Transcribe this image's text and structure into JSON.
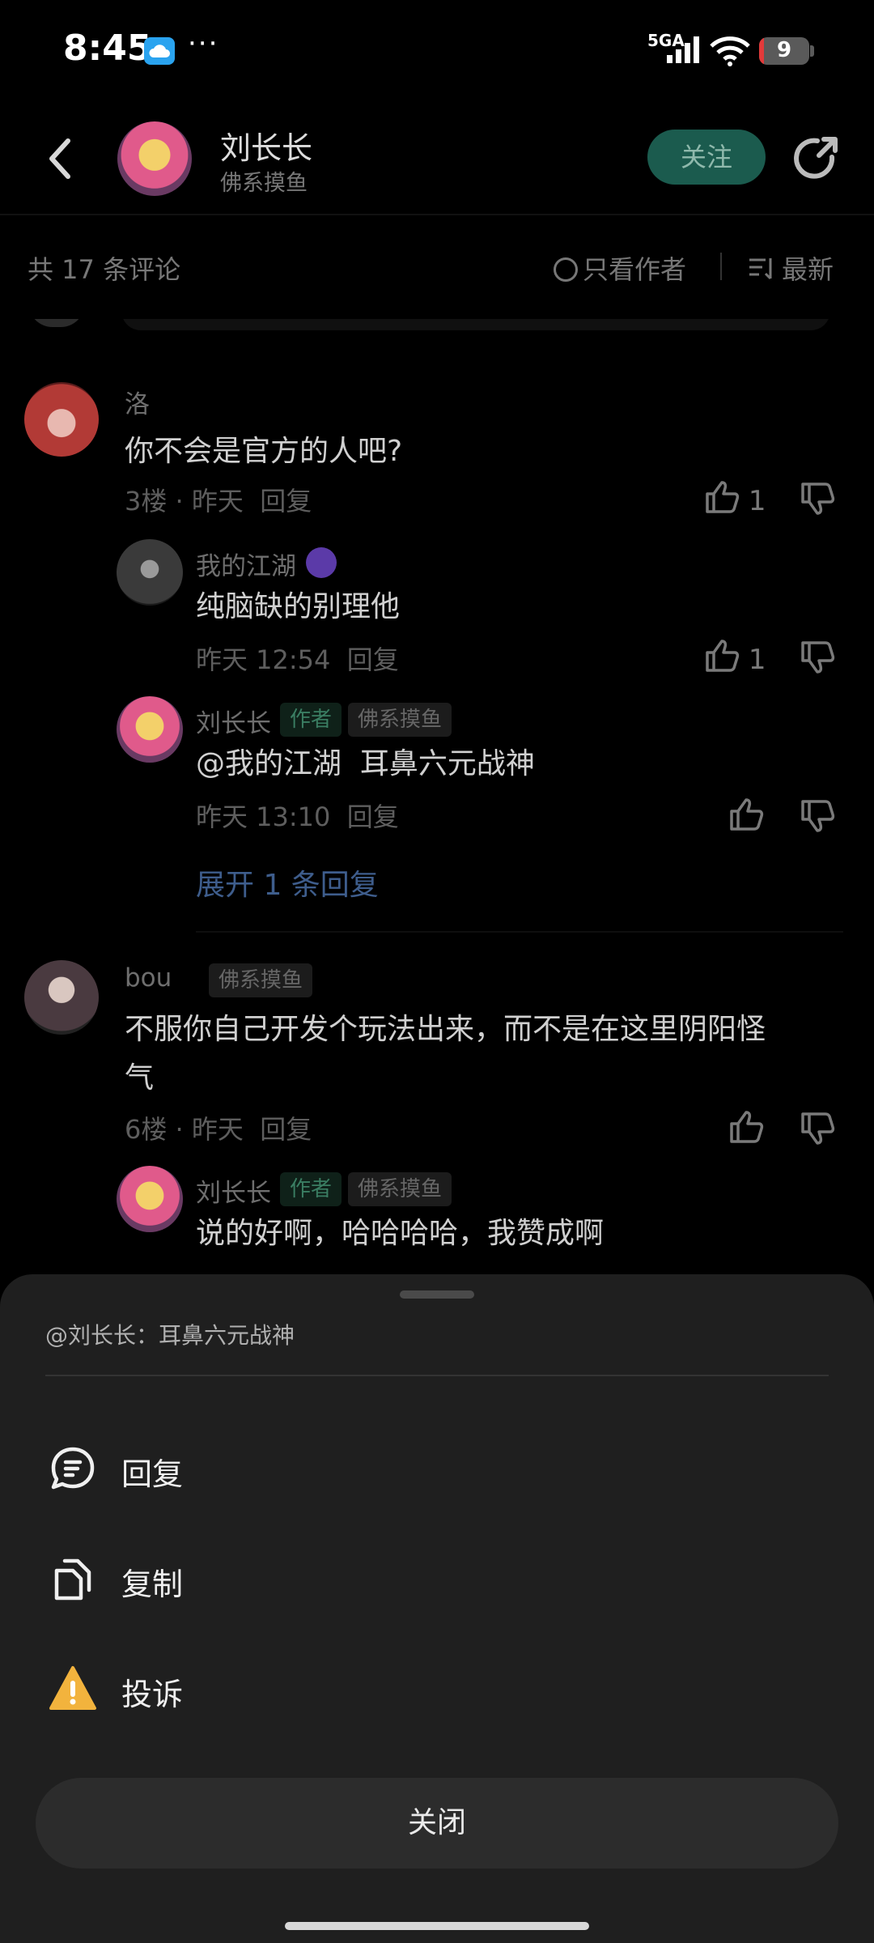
{
  "status_bar": {
    "time": "8:45",
    "network": "5GA",
    "battery": "9",
    "battery_level": 0.09,
    "icons": [
      "cloud-icon",
      "more-dots-icon",
      "signal-icon",
      "wifi-icon",
      "battery-icon"
    ],
    "more": "···"
  },
  "header": {
    "name": "刘长长",
    "subtitle": "佛系摸鱼",
    "follow_label": "关注"
  },
  "sort_bar": {
    "comment_count": "共 17 条评论",
    "author_only": "只看作者",
    "sort_label": "最新"
  },
  "comments": [
    {
      "name": "洛",
      "text": "你不会是官方的人吧?",
      "floor": "3楼",
      "time": "昨天",
      "reply": "回复",
      "likes": "1",
      "replies": [
        {
          "name": "我的江湖",
          "text": "纯脑缺的别理他",
          "time": "昨天 12:54",
          "reply": "回复",
          "likes": "1"
        },
        {
          "name": "刘长长",
          "tag_author": "作者",
          "tag": "佛系摸鱼",
          "mention": "@我的江湖",
          "text": "耳鼻六元战神",
          "time": "昨天 13:10",
          "reply": "回复"
        }
      ],
      "expand": "展开 1 条回复"
    },
    {
      "name": "bou",
      "tag": "佛系摸鱼",
      "text_line1": "不服你自己开发个玩法出来，而不是在这里阴阳怪",
      "text_line2": "气",
      "floor": "6楼",
      "time": "昨天",
      "reply": "回复",
      "replies": [
        {
          "name": "刘长长",
          "tag_author": "作者",
          "tag": "佛系摸鱼",
          "text": "说的好啊，哈哈哈哈，我赞成啊"
        }
      ]
    }
  ],
  "sheet": {
    "quote": "@刘长长：耳鼻六元战神",
    "actions": [
      {
        "label": "回复",
        "icon": "reply-icon"
      },
      {
        "label": "复制",
        "icon": "copy-icon"
      },
      {
        "label": "投诉",
        "icon": "warning-icon"
      }
    ],
    "close_label": "关闭"
  }
}
